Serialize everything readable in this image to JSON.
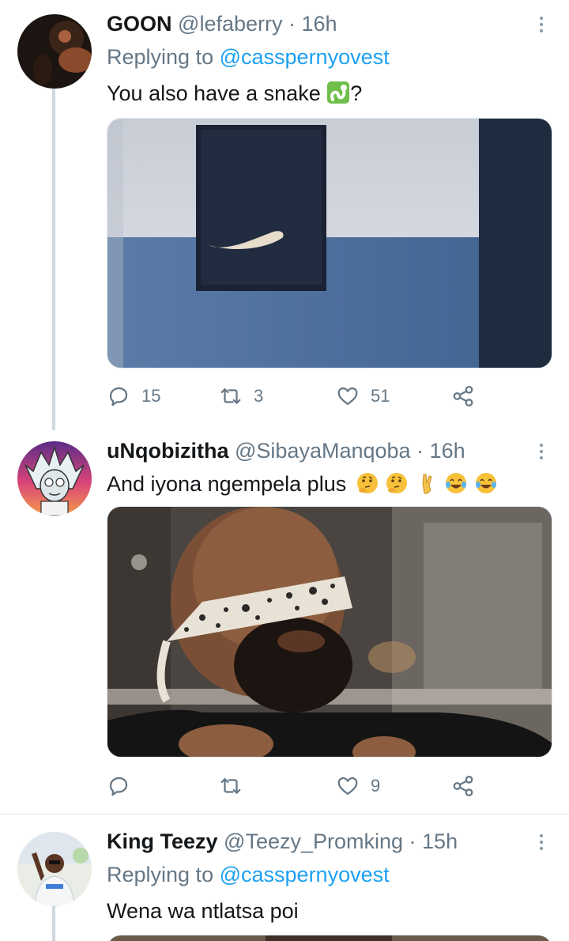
{
  "tweets": [
    {
      "name": "GOON",
      "handle": "@lefaberry",
      "time": " · 16h",
      "replying_label": "Replying to",
      "replying_to": "@casspernyovest",
      "text": "You also have a snake",
      "text_suffix": "?",
      "emojis": [
        "snake"
      ],
      "media": "Blurry photo of a dark framed picture with a white snake-shaped object on a blue wall",
      "replies": "15",
      "retweets": "3",
      "likes": "51"
    },
    {
      "name": "uNqobizitha",
      "handle": "@SibayaManqoba",
      "time": " · 16h",
      "text": "And iyona ngempela plus",
      "emojis": [
        "thinking-face",
        "thinking-face",
        "crossed-fingers",
        "tears-of-joy",
        "tears-of-joy"
      ],
      "media": "Bearded bald man with a floral blindfold over his eyes",
      "replies": "",
      "retweets": "",
      "likes": "9"
    },
    {
      "name": "King Teezy",
      "handle": "@Teezy_Promking",
      "time": " · 15h",
      "replying_label": "Replying to",
      "replying_to": "@casspernyovest",
      "text": "Wena wa ntlatsa poi"
    }
  ],
  "icons": {
    "reply": "reply-icon",
    "retweet": "retweet-icon",
    "like": "like-icon",
    "share": "share-icon",
    "more": "more-vertical-icon"
  },
  "colors": {
    "link": "#1da1f2",
    "secondary": "#657786",
    "text": "#14171a",
    "divider": "#e1e8ed"
  }
}
